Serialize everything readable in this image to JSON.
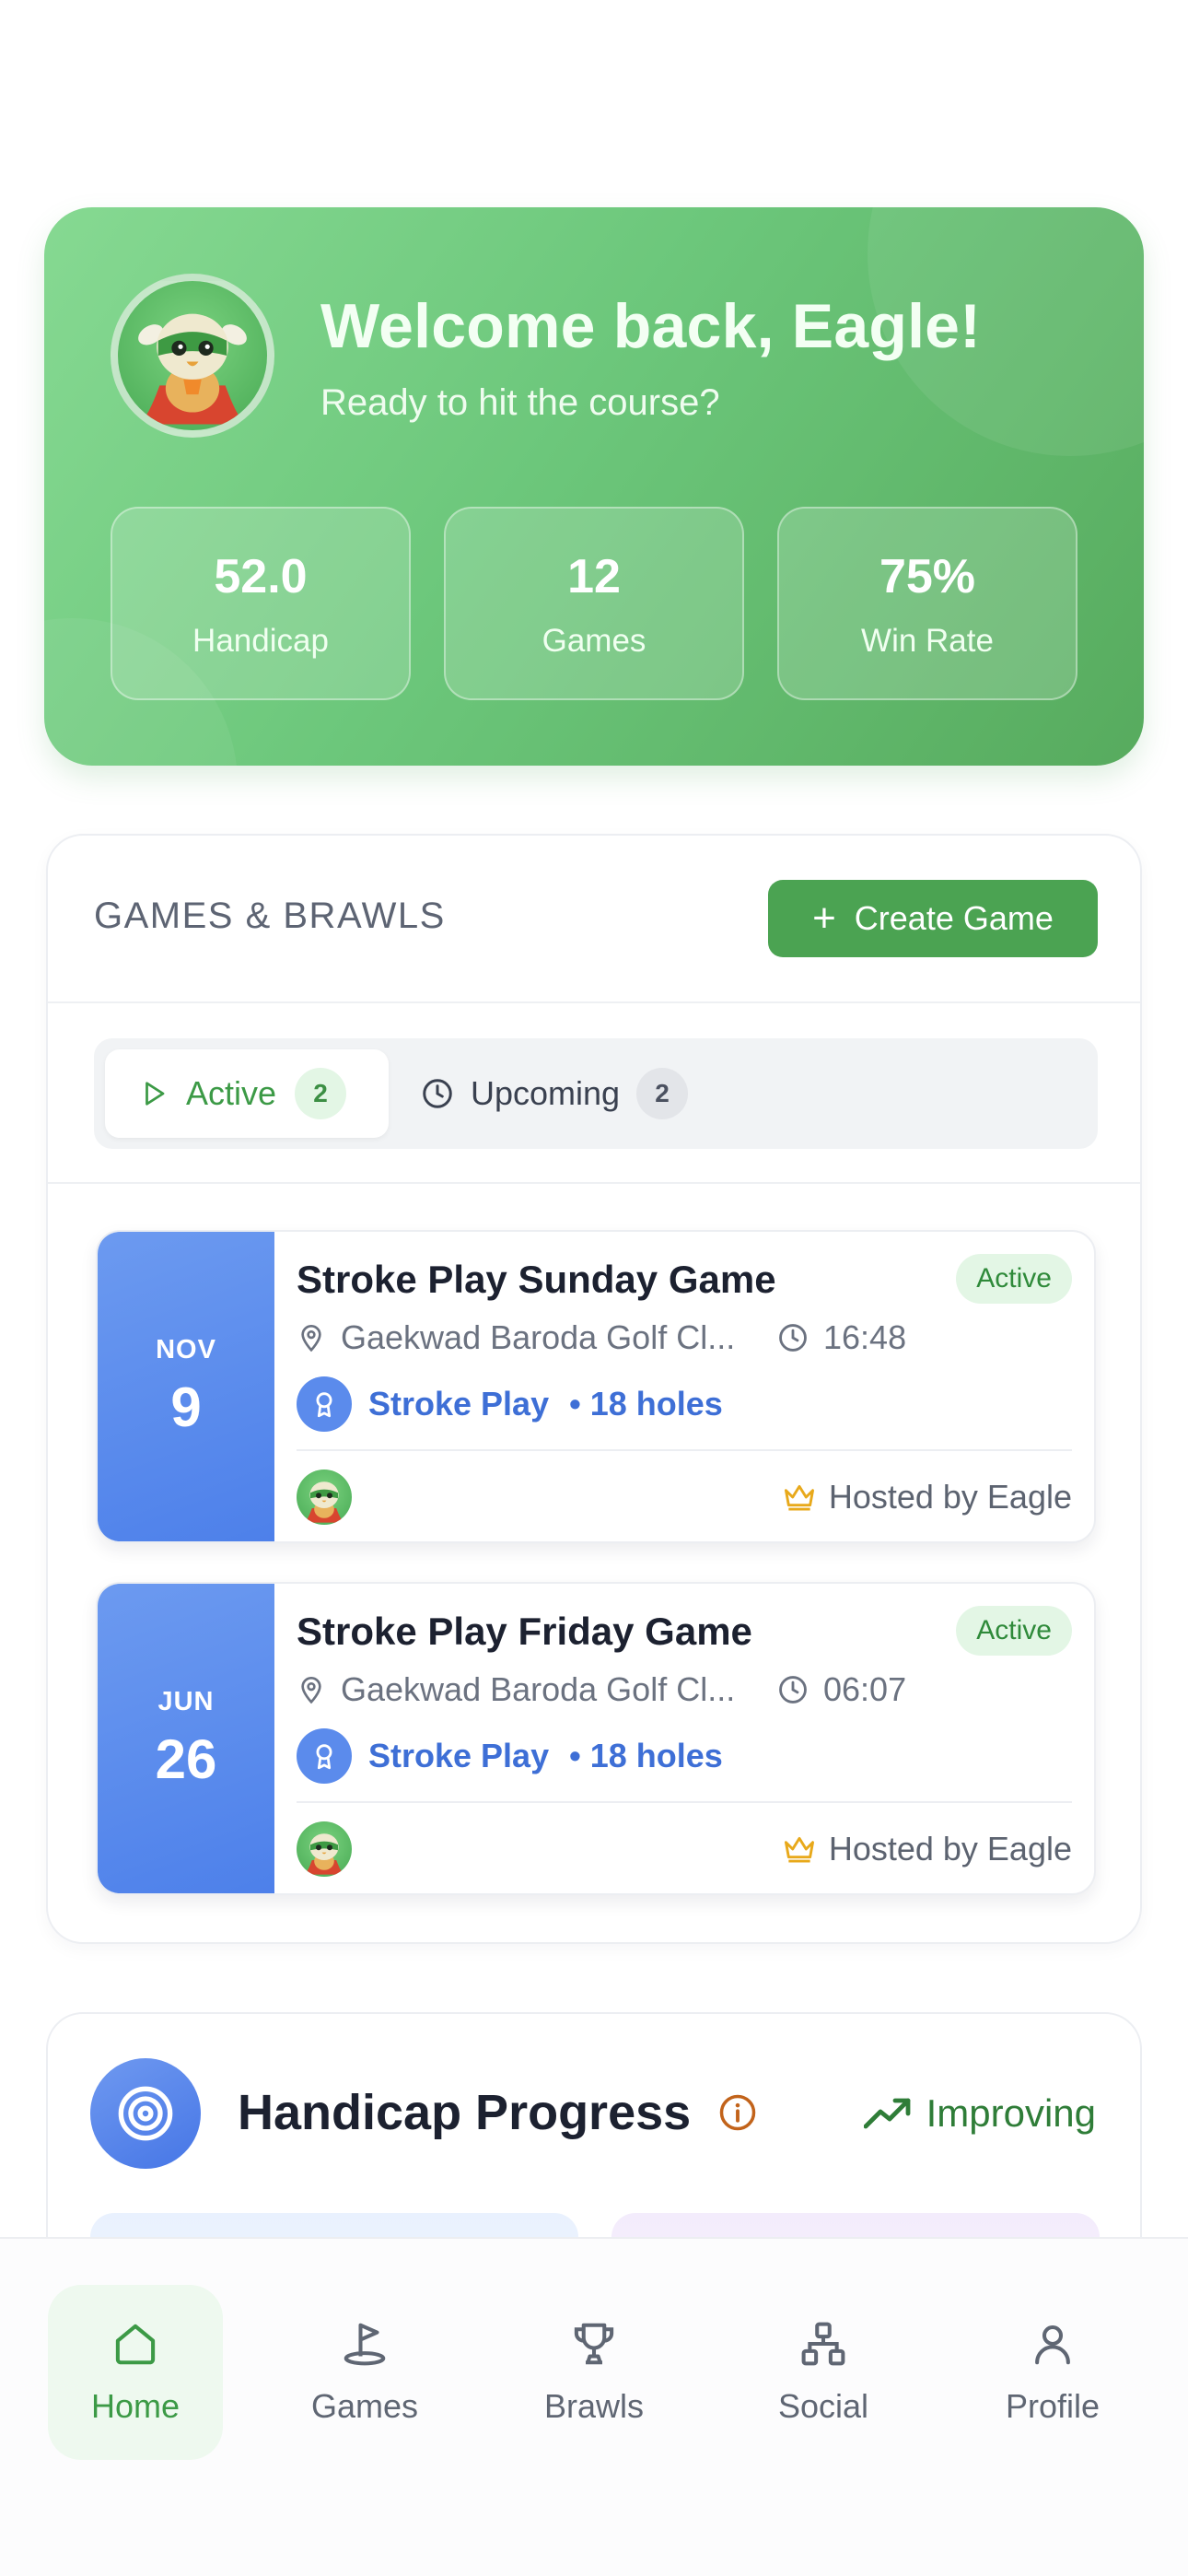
{
  "hero": {
    "welcome": "Welcome back, Eagle!",
    "subtitle": "Ready to hit the course?",
    "stats": [
      {
        "value": "52.0",
        "label": "Handicap"
      },
      {
        "value": "12",
        "label": "Games"
      },
      {
        "value": "75%",
        "label": "Win Rate"
      }
    ]
  },
  "games": {
    "section_title": "GAMES & BRAWLS",
    "create_label": "Create Game",
    "tabs": [
      {
        "label": "Active",
        "count": "2",
        "icon": "play-icon"
      },
      {
        "label": "Upcoming",
        "count": "2",
        "icon": "clock-icon"
      }
    ],
    "items": [
      {
        "month": "NOV",
        "day": "9",
        "title": "Stroke Play Sunday Game",
        "status": "Active",
        "location": "Gaekwad Baroda Golf Cl...",
        "time": "16:48",
        "type": "Stroke Play",
        "holes": "• 18 holes",
        "host": "Hosted by Eagle"
      },
      {
        "month": "JUN",
        "day": "26",
        "title": "Stroke Play Friday Game",
        "status": "Active",
        "location": "Gaekwad Baroda Golf Cl...",
        "time": "06:07",
        "type": "Stroke Play",
        "holes": "• 18 holes",
        "host": "Hosted by Eagle"
      }
    ]
  },
  "handicap": {
    "title": "Handicap Progress",
    "trend": "Improving"
  },
  "nav": [
    {
      "label": "Home",
      "icon": "home-icon",
      "active": true
    },
    {
      "label": "Games",
      "icon": "golf-flag-icon",
      "active": false
    },
    {
      "label": "Brawls",
      "icon": "trophy-icon",
      "active": false
    },
    {
      "label": "Social",
      "icon": "network-icon",
      "active": false
    },
    {
      "label": "Profile",
      "icon": "user-icon",
      "active": false
    }
  ],
  "colors": {
    "brand_green": "#4ba352",
    "accent_blue": "#4d80ea",
    "status_bg": "#e3f6e5"
  }
}
